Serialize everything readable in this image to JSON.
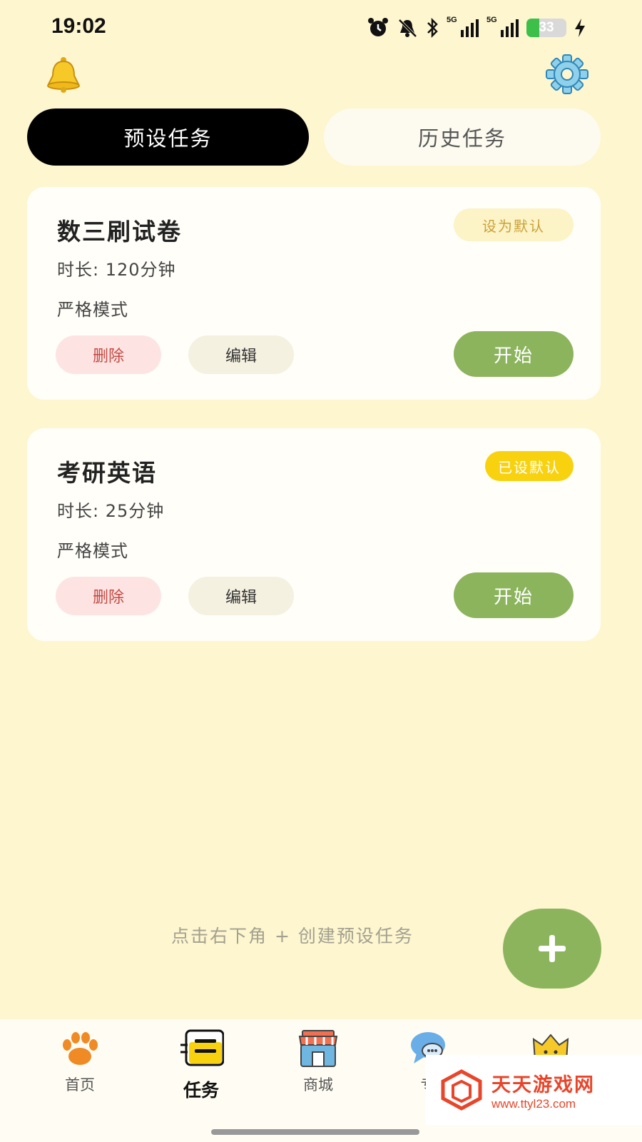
{
  "status_bar": {
    "time": "19:02",
    "battery": "33",
    "battery_level": 0.33,
    "signal_labels": [
      "5G",
      "5G"
    ],
    "icons": [
      "alarm-icon",
      "mute-bell-icon",
      "bluetooth-icon",
      "signal-icon",
      "signal-icon",
      "battery-icon",
      "charging-icon"
    ]
  },
  "header": {
    "left_icon": "bell-icon",
    "right_icon": "gear-icon"
  },
  "tabs": [
    {
      "label": "预设任务",
      "active": true
    },
    {
      "label": "历史任务",
      "active": false
    }
  ],
  "tasks": [
    {
      "title": "数三刷试卷",
      "duration": "时长: 120分钟",
      "mode": "严格模式",
      "badge": "设为默认",
      "delete_label": "删除",
      "edit_label": "编辑",
      "start_label": "开始"
    },
    {
      "title": "考研英语",
      "duration": "时长: 25分钟",
      "mode": "严格模式",
      "badge": "已设默认",
      "delete_label": "删除",
      "edit_label": "编辑",
      "start_label": "开始"
    }
  ],
  "hint": "点击右下角 + 创建预设任务",
  "fab_icon": "plus-icon",
  "bottom_nav": [
    {
      "label": "首页",
      "icon": "paw-icon",
      "active": false
    },
    {
      "label": "任务",
      "icon": "task-list-icon",
      "active": true
    },
    {
      "label": "商城",
      "icon": "shop-icon",
      "active": false
    },
    {
      "label": "专",
      "icon": "chat-bubble-icon",
      "active": false
    },
    {
      "label": "",
      "icon": "cat-face-icon",
      "active": false
    }
  ],
  "watermark": {
    "main": "天天游戏网",
    "sub": "www.ttyl23.com"
  },
  "colors": {
    "background": "#fdf6cf",
    "accent_green": "#8cb45d",
    "badge_yellow": "#f8d20e",
    "delete_pink": "#fde4e2"
  }
}
